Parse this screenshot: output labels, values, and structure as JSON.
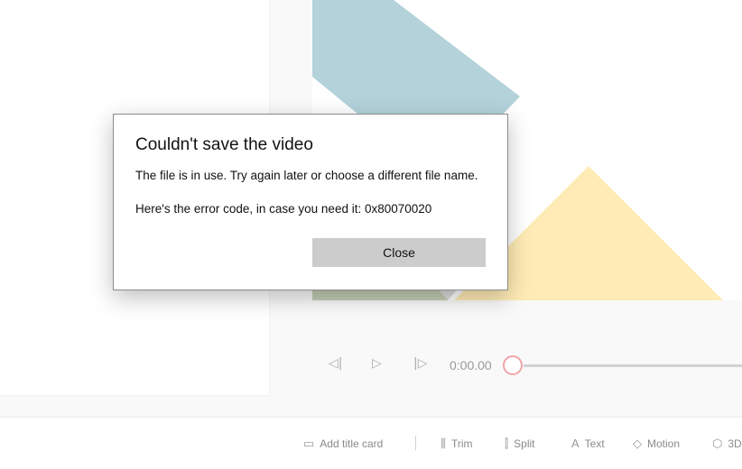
{
  "dialog": {
    "title": "Couldn't save the video",
    "message": "The file is in use. Try again later or choose a different file name.",
    "error_line": "Here's the error code, in case you need it: 0x80070020",
    "close_label": "Close"
  },
  "player": {
    "time": "0:00.00",
    "progress": 0,
    "prev_icon": "step-back-icon",
    "play_icon": "play-icon",
    "next_icon": "step-forward-icon"
  },
  "toolbar": {
    "items": [
      {
        "label": "Add title card",
        "icon": "title-card-icon",
        "glyph": "▭"
      },
      {
        "label": "Trim",
        "icon": "trim-icon",
        "glyph": "⫼"
      },
      {
        "label": "Split",
        "icon": "split-icon",
        "glyph": "⫿"
      },
      {
        "label": "Text",
        "icon": "text-icon",
        "glyph": "A"
      },
      {
        "label": "Motion",
        "icon": "motion-icon",
        "glyph": "◇"
      },
      {
        "label": "3D",
        "icon": "3d-effects-icon",
        "glyph": "⬡"
      }
    ]
  },
  "colors": {
    "blue_shape": "#b3d2da",
    "yellow_shape": "#feebb5",
    "green_shape": "#c3cdb4",
    "thumb": "#f1a3aa"
  }
}
